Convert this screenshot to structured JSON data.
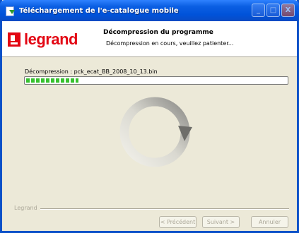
{
  "window": {
    "title": "Téléchargement de l'e-catalogue mobile",
    "minimize_label": "_",
    "maximize_label": "□",
    "close_label": "X"
  },
  "header": {
    "logo_text": "legrand",
    "title": "Décompression du programme",
    "subtitle": "Décompression en cours, veuillez patienter..."
  },
  "main": {
    "file_label": "Décompression : pck_ecat_BB_2008_10_13.bin",
    "progress_fraction": 0.2
  },
  "footer": {
    "group_label": "Legrand",
    "prev_label": "< Précédent",
    "next_label": "Suivant >",
    "cancel_label": "Annuler"
  },
  "colors": {
    "brand": "#e30613",
    "progress": "#37c12e",
    "titlebar": "#0052d9"
  }
}
